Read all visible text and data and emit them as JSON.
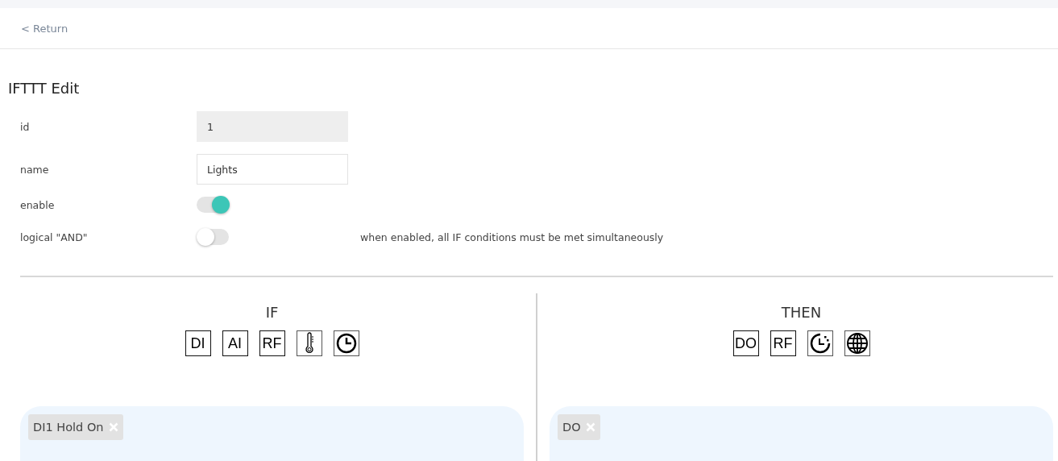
{
  "header": {
    "back_link": "< Return"
  },
  "title": "IFTTT Edit",
  "fields": [
    {
      "kind": "input",
      "label": "id",
      "value": "1",
      "disabled": true
    },
    {
      "kind": "input",
      "label": "name",
      "value": "Lights",
      "disabled": false
    },
    {
      "kind": "toggle",
      "label": "enable",
      "on": true
    },
    {
      "kind": "toggle",
      "label": "logical \"AND\"",
      "on": false,
      "hint": "when enabled, all IF conditions must be met simultaneously"
    }
  ],
  "sections": [
    {
      "title": "IF",
      "tools": [
        {
          "kind": "text",
          "label": "DI"
        },
        {
          "kind": "text",
          "label": "AI"
        },
        {
          "kind": "text",
          "label": "RF"
        },
        {
          "kind": "thermometer"
        },
        {
          "kind": "clock"
        }
      ],
      "tags": [
        {
          "label": "DI1 Hold On"
        }
      ]
    },
    {
      "title": "THEN",
      "tools": [
        {
          "kind": "text",
          "label": "DO"
        },
        {
          "kind": "text",
          "label": "RF"
        },
        {
          "kind": "timer"
        },
        {
          "kind": "globe"
        }
      ],
      "tags": [
        {
          "label": "DO"
        }
      ]
    }
  ]
}
